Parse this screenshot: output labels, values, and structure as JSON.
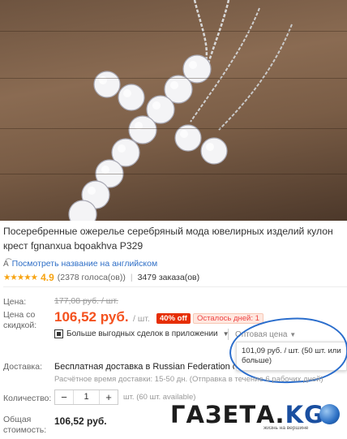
{
  "product": {
    "title": "Посеребренные ожерелье серебряный мода ювелирных изделий кулон крест fgnanxua bqoakhva P329",
    "translate_link": "Посмотреть название на английском",
    "rating": "4.9",
    "votes": "(2378 голоса(ов))",
    "orders": "3479 заказа(ов)"
  },
  "pricing": {
    "price_label": "Цена:",
    "discount_label": "Цена со скидкой:",
    "old_price": "177,08 руб. / шт.",
    "price": "106,52 руб.",
    "per_unit": "/ шт.",
    "off_badge": "40% off",
    "days_left": "Осталось дней: 1",
    "deals_link": "Больше выгодных сделок в приложении",
    "wholesale_label": "Оптовая цена",
    "wholesale_popup": "101,09 руб. / шт. (50 шт. или больше)"
  },
  "shipping": {
    "label": "Доставка:",
    "title": "Бесплатная доставка в Russian Federation служ",
    "subtitle": "Расчётное время доставки: 15-50 дн. (Отправка в течение 6 рабочих дней)"
  },
  "quantity": {
    "label": "Количество:",
    "value": "1",
    "minus": "−",
    "plus": "+",
    "available": "шт. (60 шт. available)"
  },
  "total": {
    "label": "Общая стоимость:",
    "value": "106,52 руб."
  },
  "watermark": {
    "brand": "ГАЗЕТА.",
    "brand_suffix": "KG",
    "tagline": "жизнь на вершине"
  },
  "colors": {
    "accent_price": "#f4511e",
    "badge_red": "#e62e04",
    "link_blue": "#2f6fc7",
    "star": "#f7a311"
  }
}
